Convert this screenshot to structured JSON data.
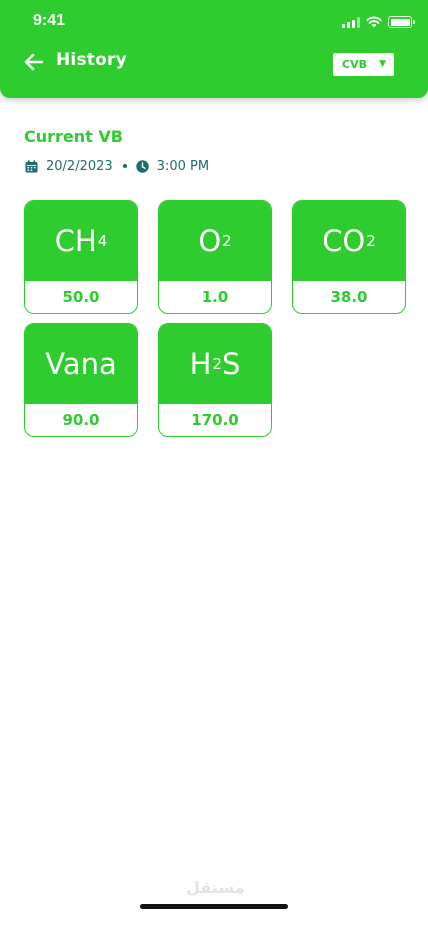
{
  "status_bar": {
    "time": "9:41"
  },
  "header": {
    "title": "History",
    "back_icon": "arrow-left-icon",
    "dropdown": {
      "selected": "CVB",
      "arrow_icon": "triangle-down-icon"
    }
  },
  "section": {
    "title": "Current VB",
    "date": "20/2/2023",
    "time": "3:00 PM",
    "date_icon": "calendar-icon",
    "time_icon": "clock-icon"
  },
  "cards": [
    {
      "name": "CH",
      "subscript": "4",
      "value": "50.0"
    },
    {
      "name": "O",
      "subscript": "2",
      "value": "1.0"
    },
    {
      "name": "CO",
      "subscript": "2",
      "value": "38.0"
    },
    {
      "name": "Vana",
      "subscript": "",
      "value": "90.0"
    },
    {
      "name": "H",
      "subscript": "2",
      "suffix": "S",
      "value": "170.0"
    }
  ],
  "colors": {
    "primary": "#2ecc2e",
    "meta": "#1f6b6b",
    "background": "#ffffff"
  }
}
